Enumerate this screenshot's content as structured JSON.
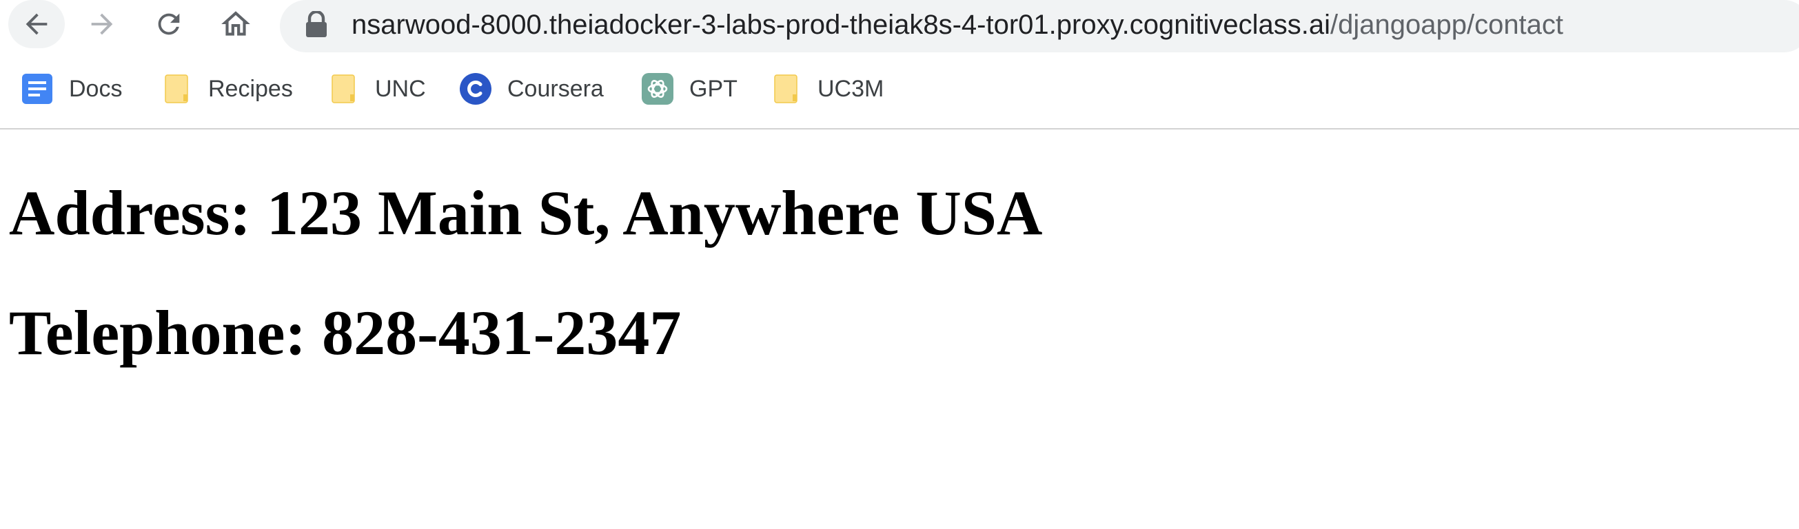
{
  "browser": {
    "nav": {
      "back_icon": "arrow-left-icon",
      "forward_icon": "arrow-right-icon",
      "reload_icon": "reload-icon",
      "home_icon": "home-icon"
    },
    "address_bar": {
      "host": "nsarwood-8000.theiadocker-3-labs-prod-theiak8s-4-tor01.proxy.cognitiveclass.ai",
      "path": "/djangoapp/contact",
      "lock_icon": "lock-icon"
    },
    "bookmarks": [
      {
        "label": "Docs",
        "icon": "google-docs-icon"
      },
      {
        "label": "Recipes",
        "icon": "folder-icon"
      },
      {
        "label": "UNC",
        "icon": "folder-icon"
      },
      {
        "label": "Coursera",
        "icon": "coursera-icon"
      },
      {
        "label": "GPT",
        "icon": "openai-icon"
      },
      {
        "label": "UC3M",
        "icon": "folder-icon"
      }
    ]
  },
  "page": {
    "address_line": "Address: 123 Main St, Anywhere USA",
    "telephone_line": "Telephone: 828-431-2347"
  },
  "colors": {
    "toolbar_bg": "#ffffff",
    "omnibox_bg": "#f1f3f4",
    "url_host": "#202124",
    "url_path": "#5f6368",
    "folder": "#fde293",
    "docs_blue": "#4285f4",
    "coursera_blue": "#2a56c6",
    "gpt_green": "#74aa9c"
  }
}
